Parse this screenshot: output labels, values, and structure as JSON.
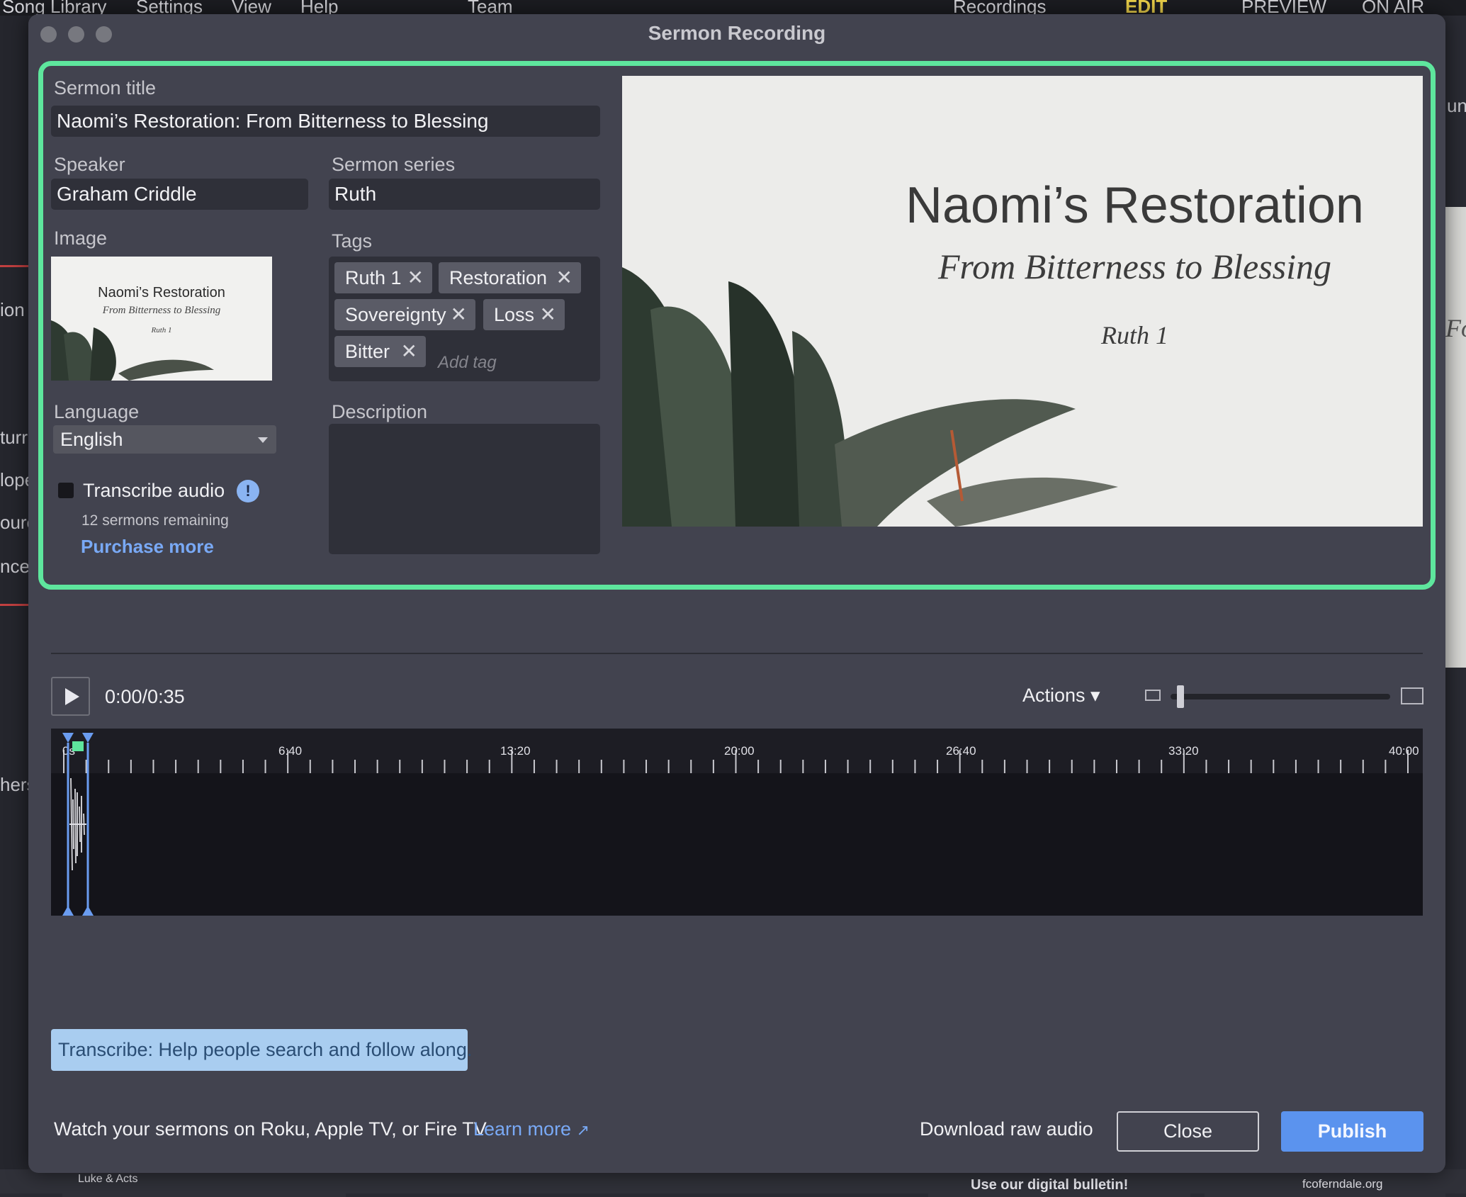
{
  "background": {
    "menubar": [
      "Song Library",
      "Settings",
      "View",
      "Help",
      "Team",
      "Recordings",
      "EDIT",
      "PREVIEW",
      "ON AIR"
    ],
    "left_fragments": [
      "ion",
      "turr",
      "lope",
      "ourc",
      "nce a",
      "hers"
    ],
    "right_fragments": [
      "un",
      "For"
    ],
    "bottom_fragments": [
      "Luke & Acts",
      "Use our digital bulletin!",
      "fcoferndale.org"
    ]
  },
  "dialog": {
    "title": "Sermon Recording",
    "sermon_title_label": "Sermon title",
    "sermon_title_value": "Naomi’s Restoration: From Bitterness to Blessing",
    "speaker_label": "Speaker",
    "speaker_value": "Graham Criddle",
    "series_label": "Sermon series",
    "series_value": "Ruth",
    "image_label": "Image",
    "tags_label": "Tags",
    "tags": [
      "Ruth 1",
      "Restoration",
      "Sovereignty",
      "Loss",
      "Bitter"
    ],
    "add_tag_placeholder": "Add tag",
    "language_label": "Language",
    "language_value": "English",
    "transcribe_label": "Transcribe audio",
    "info_icon_text": "!",
    "transcribe_checked": false,
    "sermons_remaining": "12 sermons remaining",
    "purchase_more": "Purchase more",
    "description_label": "Description",
    "description_value": "",
    "preview": {
      "title": "Naomi’s Restoration",
      "subtitle": "From Bitterness to Blessing",
      "reference": "Ruth 1"
    }
  },
  "player": {
    "time": "0:00/0:35",
    "actions_label": "Actions ▾",
    "zoom_level": 0.03,
    "ruler_labels": [
      "0s",
      "6:40",
      "13:20",
      "20:00",
      "26:40",
      "33:20",
      "40:00"
    ]
  },
  "banner": "Transcribe: Help people search and follow along.",
  "footer": {
    "watch_text": "Watch your sermons on Roku, Apple TV, or Fire TV",
    "learn_more": "Learn more",
    "download": "Download raw audio",
    "close": "Close",
    "publish": "Publish"
  },
  "colors": {
    "accent_green": "#5ee69d",
    "link_blue": "#79a9f5",
    "publish_blue": "#5b93ee",
    "dialog_bg": "#42434f"
  }
}
